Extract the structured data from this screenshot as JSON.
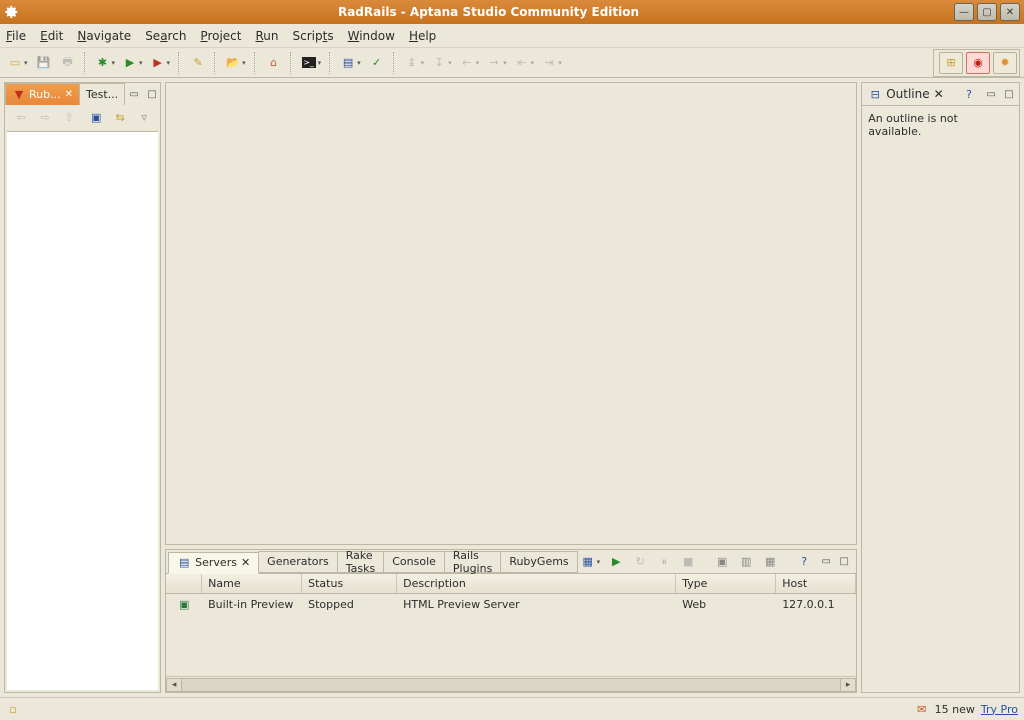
{
  "window": {
    "title": "RadRails - Aptana Studio Community Edition"
  },
  "menu": {
    "file": "File",
    "edit": "Edit",
    "navigate": "Navigate",
    "search": "Search",
    "project": "Project",
    "run": "Run",
    "scripts": "Scripts",
    "window": "Window",
    "help": "Help"
  },
  "left": {
    "tabs": [
      {
        "label": "Rub...",
        "active": true
      },
      {
        "label": "Test...",
        "active": false
      }
    ]
  },
  "outline": {
    "title": "Outline",
    "message": "An outline is not available."
  },
  "bottom": {
    "tabs": [
      {
        "label": "Servers",
        "active": true
      },
      {
        "label": "Generators"
      },
      {
        "label": "Rake Tasks"
      },
      {
        "label": "Console"
      },
      {
        "label": "Rails Plugins"
      },
      {
        "label": "RubyGems"
      }
    ],
    "columns": {
      "name": "Name",
      "status": "Status",
      "description": "Description",
      "type": "Type",
      "host": "Host"
    },
    "rows": [
      {
        "name": "Built-in Preview",
        "status": "Stopped",
        "description": "HTML Preview Server",
        "type": "Web",
        "host": "127.0.0.1"
      }
    ]
  },
  "status": {
    "new_count": "15 new",
    "trypro": "Try Pro"
  }
}
